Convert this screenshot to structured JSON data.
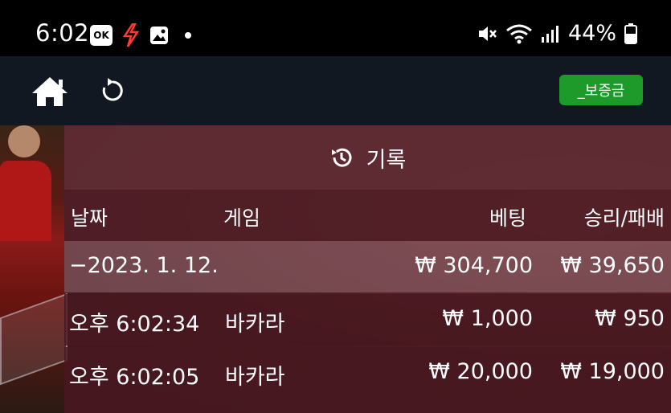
{
  "status_bar": {
    "time": "6:02",
    "ok_badge": "OK",
    "battery": "44%"
  },
  "toolbar": {
    "deposit_label": "_보증금"
  },
  "history": {
    "title": "기록",
    "columns": {
      "date": "날짜",
      "game": "게임",
      "bet": "베팅",
      "win_loss": "승리/패배"
    },
    "groups": [
      {
        "date": "−2023. 1. 12.",
        "total_bet": "₩ 304,700",
        "total_win_loss": "₩ 39,650",
        "rows": [
          {
            "time": "오후 6:02:34",
            "game": "바카라",
            "bet": "₩ 1,000",
            "win_loss": "₩ 950"
          },
          {
            "time": "오후 6:02:05",
            "game": "바카라",
            "bet": "₩ 20,000",
            "win_loss": "₩ 19,000"
          }
        ]
      }
    ]
  },
  "colors": {
    "deposit_button": "#1e9a2a",
    "toolbar_bg": "#121821",
    "header_bg": "#5f2d34"
  }
}
